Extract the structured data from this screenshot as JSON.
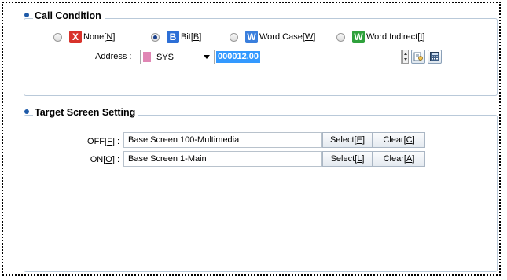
{
  "call_condition": {
    "title": "Call Condition",
    "options": [
      {
        "name": "None",
        "key": "N",
        "icon": "x-icon",
        "glyph": "X",
        "checked": false
      },
      {
        "name": "Bit",
        "key": "B",
        "icon": "bit-icon",
        "glyph": "B",
        "checked": true
      },
      {
        "name": "Word Case",
        "key": "W",
        "icon": "word-case-icon",
        "glyph": "W",
        "checked": false
      },
      {
        "name": "Word Indirect",
        "key": "I",
        "icon": "word-indirect-icon",
        "glyph": "W",
        "checked": false
      }
    ],
    "address_label": "Address :",
    "device_value": "SYS",
    "address_value": "000012.00"
  },
  "target_screen": {
    "title": "Target Screen Setting",
    "rows": [
      {
        "label": "OFF",
        "key": "F",
        "value": "Base Screen 100-Multimedia",
        "select_label": "Select",
        "select_key": "E",
        "clear_label": "Clear",
        "clear_key": "C"
      },
      {
        "label": "ON",
        "key": "O",
        "value": "Base Screen 1-Main",
        "select_label": "Select",
        "select_key": "L",
        "clear_label": "Clear",
        "clear_key": "A"
      }
    ]
  },
  "colors": {
    "accent": "#1e5aa8",
    "selection": "#3399ff",
    "none_icon": "#d8322b",
    "bit_icon": "#2d6fd6",
    "word_icon": "#3a7fdd",
    "word_indirect_icon": "#2fa13c",
    "device_swatch": "#e086b4"
  }
}
